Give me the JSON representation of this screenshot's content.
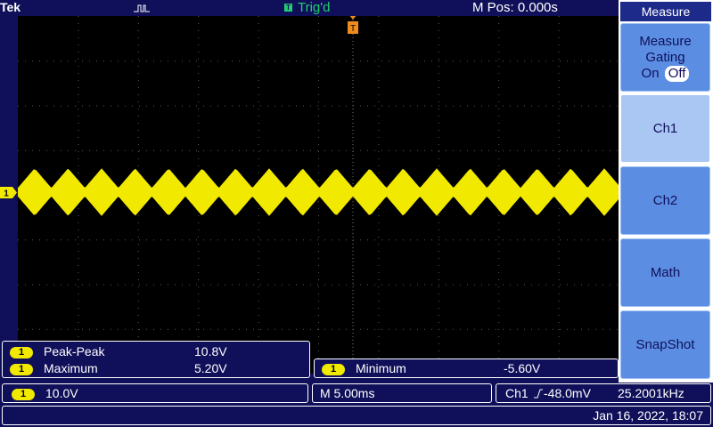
{
  "header": {
    "brand": "Tek",
    "trigger_status": "Trig'd",
    "trigger_status_icon": "T",
    "position": "M Pos: 0.000s",
    "acquire_icon": "pulse-icon",
    "trigger_position_icon": "T"
  },
  "channel_marker": "1",
  "menu": {
    "title": "Measure",
    "gating": {
      "line1": "Measure",
      "line2": "Gating",
      "on": "On",
      "off": "Off"
    },
    "buttons": [
      "Ch1",
      "Ch2",
      "Math",
      "SnapShot"
    ]
  },
  "measurements": {
    "left": [
      {
        "channel": "1",
        "label": "Peak-Peak",
        "value": "10.8V"
      },
      {
        "channel": "1",
        "label": "Maximum",
        "value": "5.20V"
      }
    ],
    "right": {
      "channel": "1",
      "label": "Minimum",
      "value": "-5.60V"
    }
  },
  "status": {
    "channel": "1",
    "volts_div": "10.0V",
    "timebase": "M 5.00ms",
    "trigger_source": "Ch1",
    "trigger_slope_icon": "rising-edge-icon",
    "trigger_level": "-48.0mV",
    "frequency": "25.2001kHz",
    "datetime": "Jan 16, 2022, 18:07"
  },
  "colors": {
    "trace": "#f2e900",
    "background": "#10105a",
    "trigger_marker": "#f08c1e",
    "trig_status": "#1fd06e",
    "button": "#5b8ee3",
    "button_selected": "#aac6f3"
  }
}
